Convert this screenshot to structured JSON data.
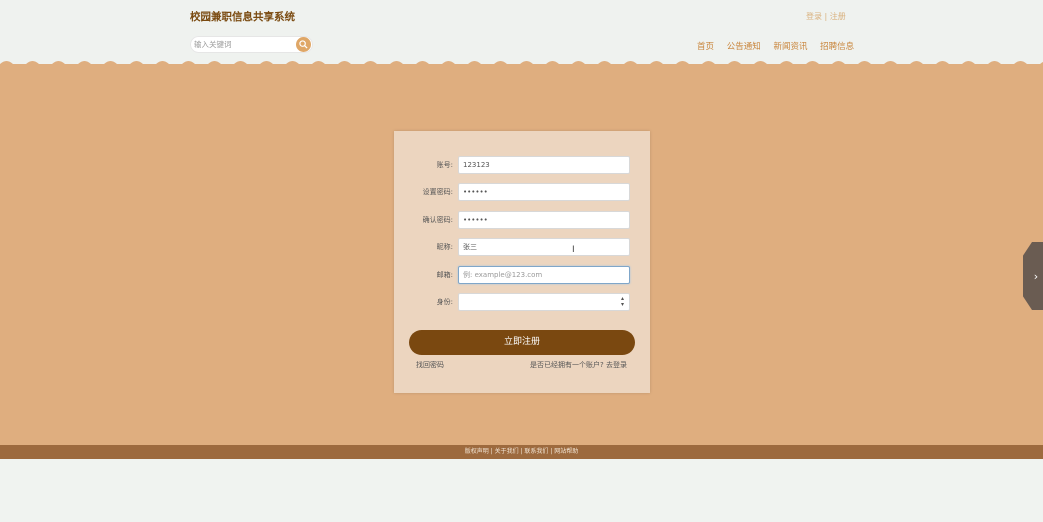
{
  "header": {
    "site_title": "校园兼职信息共享系统",
    "login": "登录",
    "separator": " | ",
    "register": "注册",
    "search_placeholder": "输入关键词",
    "nav": [
      "首页",
      "公告通知",
      "新闻资讯",
      "招聘信息"
    ]
  },
  "form": {
    "fields": [
      {
        "label": "账号:",
        "value": "123123"
      },
      {
        "label": "设置密码:",
        "value": "••••••"
      },
      {
        "label": "确认密码:",
        "value": "••••••"
      },
      {
        "label": "昵称:",
        "value": "张三"
      },
      {
        "label": "邮箱:",
        "value": "",
        "placeholder": "例: example@123.com"
      },
      {
        "label": "身份:",
        "value": ""
      }
    ],
    "submit_label": "立即注册",
    "forgot_link": "找回密码",
    "login_link": "是否已经拥有一个账户? 去登录"
  },
  "side_tab_glyph": "›",
  "footer": {
    "links": [
      "版权声明",
      "关于我们",
      "联系我们",
      "网站帮助"
    ],
    "separator": " | "
  },
  "colors": {
    "brand": "#7a4810",
    "accent": "#dfa767",
    "page_bg": "#dfae7f",
    "footer_bg": "#9d6a3e"
  }
}
